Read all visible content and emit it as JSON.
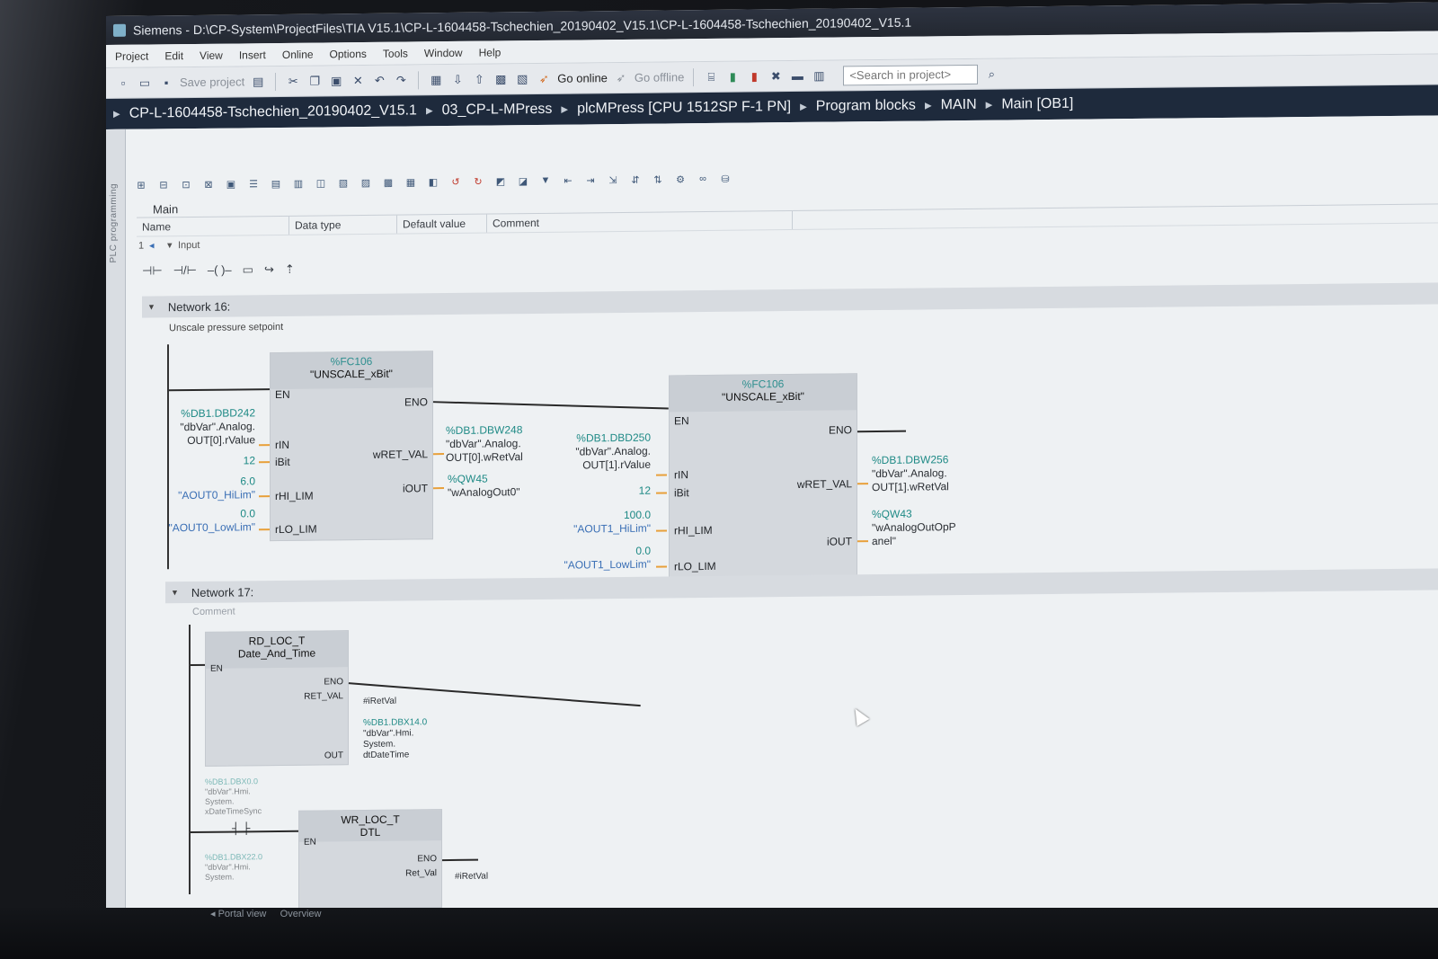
{
  "window": {
    "title": "Siemens  -  D:\\CP-System\\ProjectFiles\\TIA V15.1\\CP-L-1604458-Tschechien_20190402_V15.1\\CP-L-1604458-Tschechien_20190402_V15.1"
  },
  "menu": [
    "Project",
    "Edit",
    "View",
    "Insert",
    "Online",
    "Options",
    "Tools",
    "Window",
    "Help"
  ],
  "toolbar": {
    "save_label": "Save project",
    "go_online": "Go online",
    "go_offline": "Go offline",
    "search_placeholder": "<Search in project>"
  },
  "breadcrumb": [
    "CP-L-1604458-Tschechien_20190402_V15.1",
    "03_CP-L-MPress",
    "plcMPress [CPU 1512SP F-1 PN]",
    "Program blocks",
    "MAIN",
    "Main [OB1]"
  ],
  "sidebar_tab": "PLC programming",
  "interface": {
    "title": "Main",
    "columns": [
      "Name",
      "Data type",
      "Default value",
      "Comment"
    ],
    "rows": [
      {
        "index": "1",
        "name": "Input"
      }
    ]
  },
  "networks": [
    {
      "title": "Network 16:",
      "comment": "Unscale pressure setpoint",
      "blocks": [
        {
          "addr": "%FC106",
          "name": "\"UNSCALE_xBit\"",
          "pins_in": [
            "EN",
            "rIN",
            "iBit",
            "rHI_LIM",
            "rLO_LIM"
          ],
          "pins_out": [
            "ENO",
            "wRET_VAL",
            "iOUT"
          ],
          "operands_in": [
            {
              "addr": "%DB1.DBD242",
              "lines": [
                "\"dbVar\".Analog.",
                "OUT[0].rValue"
              ]
            },
            {
              "const": "12"
            },
            {
              "const": "6.0",
              "name": "\"AOUT0_HiLim\""
            },
            {
              "const": "0.0",
              "name": "\"AOUT0_LowLim\""
            }
          ],
          "operands_out": [
            {
              "addr": "%DB1.DBW248",
              "lines": [
                "\"dbVar\".Analog.",
                "OUT[0].wRetVal"
              ]
            },
            {
              "addr": "%QW45",
              "lines": [
                "\"wAnalogOut0\""
              ]
            }
          ]
        },
        {
          "addr": "%FC106",
          "name": "\"UNSCALE_xBit\"",
          "pins_in": [
            "EN",
            "rIN",
            "iBit",
            "rHI_LIM",
            "rLO_LIM"
          ],
          "pins_out": [
            "ENO",
            "wRET_VAL",
            "iOUT"
          ],
          "operands_in": [
            {
              "addr": "%DB1.DBD250",
              "lines": [
                "\"dbVar\".Analog.",
                "OUT[1].rValue"
              ]
            },
            {
              "const": "12"
            },
            {
              "const": "100.0",
              "name": "\"AOUT1_HiLim\""
            },
            {
              "const": "0.0",
              "name": "\"AOUT1_LowLim\""
            }
          ],
          "operands_out": [
            {
              "addr": "%DB1.DBW256",
              "lines": [
                "\"dbVar\".Analog.",
                "OUT[1].wRetVal"
              ]
            },
            {
              "addr": "%QW43",
              "lines": [
                "\"wAnalogOutOpP",
                "anel\""
              ]
            }
          ]
        }
      ]
    },
    {
      "title": "Network 17:",
      "comment": "Comment",
      "blocks": [
        {
          "name": "RD_LOC_T",
          "type": "Date_And_Time",
          "pins_in": [
            "EN"
          ],
          "pins_out": [
            "ENO",
            "RET_VAL",
            "OUT"
          ],
          "operands_out": [
            {
              "lines": [
                "#iRetVal"
              ]
            },
            {
              "addr": "%DB1.DBX14.0",
              "lines": [
                "\"dbVar\".Hmi.",
                "System.",
                "dtDateTime"
              ]
            }
          ]
        },
        {
          "name": "WR_LOC_T",
          "type": "DTL",
          "pins_in": [
            "EN"
          ],
          "pins_out": [
            "ENO",
            "Ret_Val"
          ],
          "operands_in": [
            {
              "addr": "%DB1.DBX0.0",
              "lines": [
                "\"dbVar\".Hmi.",
                "System.",
                "xDateTimeSync"
              ]
            },
            {
              "addr": "%DB1.DBX22.0",
              "lines": [
                "\"dbVar\".Hmi.",
                "System."
              ]
            }
          ],
          "operands_out": [
            {
              "lines": [
                "#iRetVal"
              ]
            }
          ]
        }
      ]
    }
  ],
  "status": {
    "portal_view": "Portal view",
    "overview": "Overview"
  }
}
